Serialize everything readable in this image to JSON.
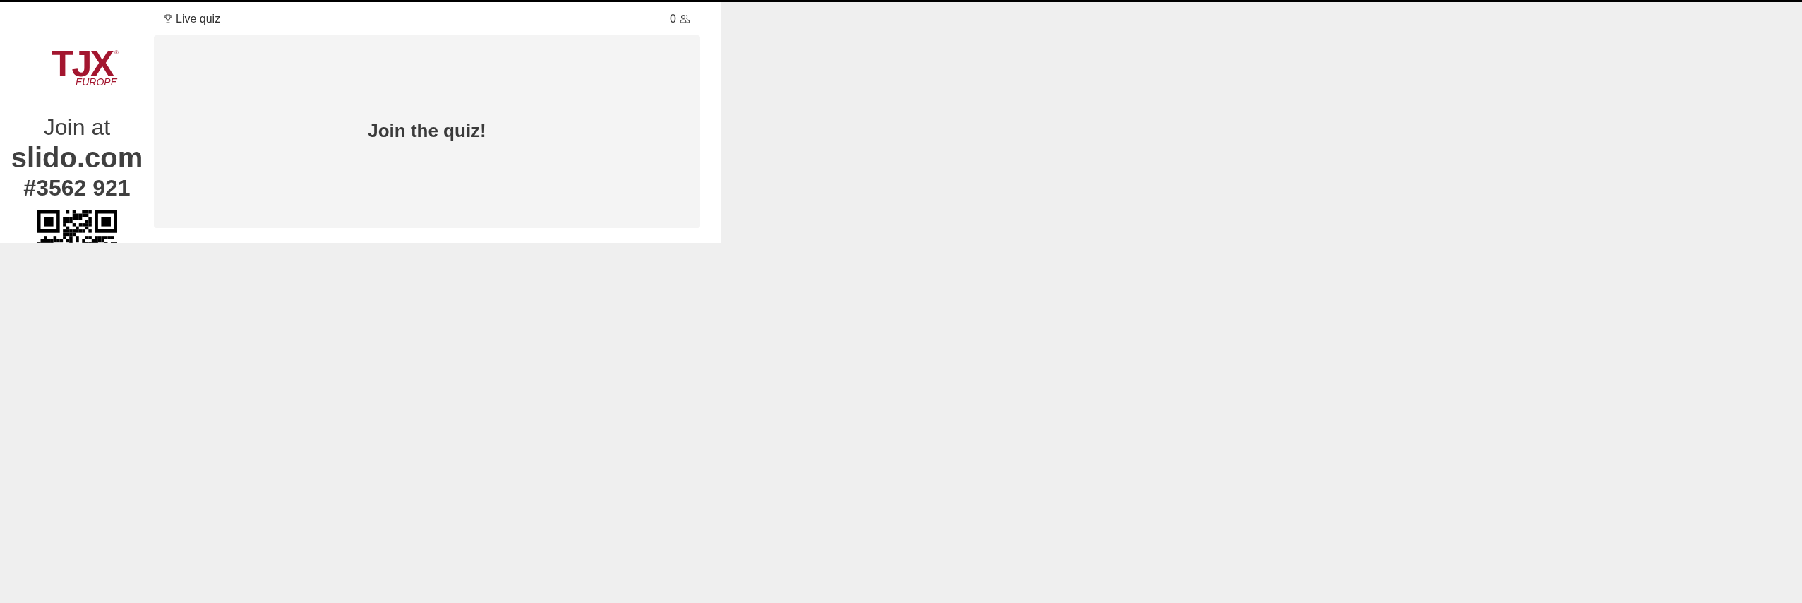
{
  "sidebar": {
    "logo": {
      "mark": "TJX",
      "sub": "EUROPE",
      "registered": "®"
    },
    "join_label": "Join at",
    "site": "slido.com",
    "code": "#3562 921"
  },
  "header": {
    "title": "Live quiz",
    "participants": "0"
  },
  "main": {
    "message": "Join the quiz!"
  }
}
